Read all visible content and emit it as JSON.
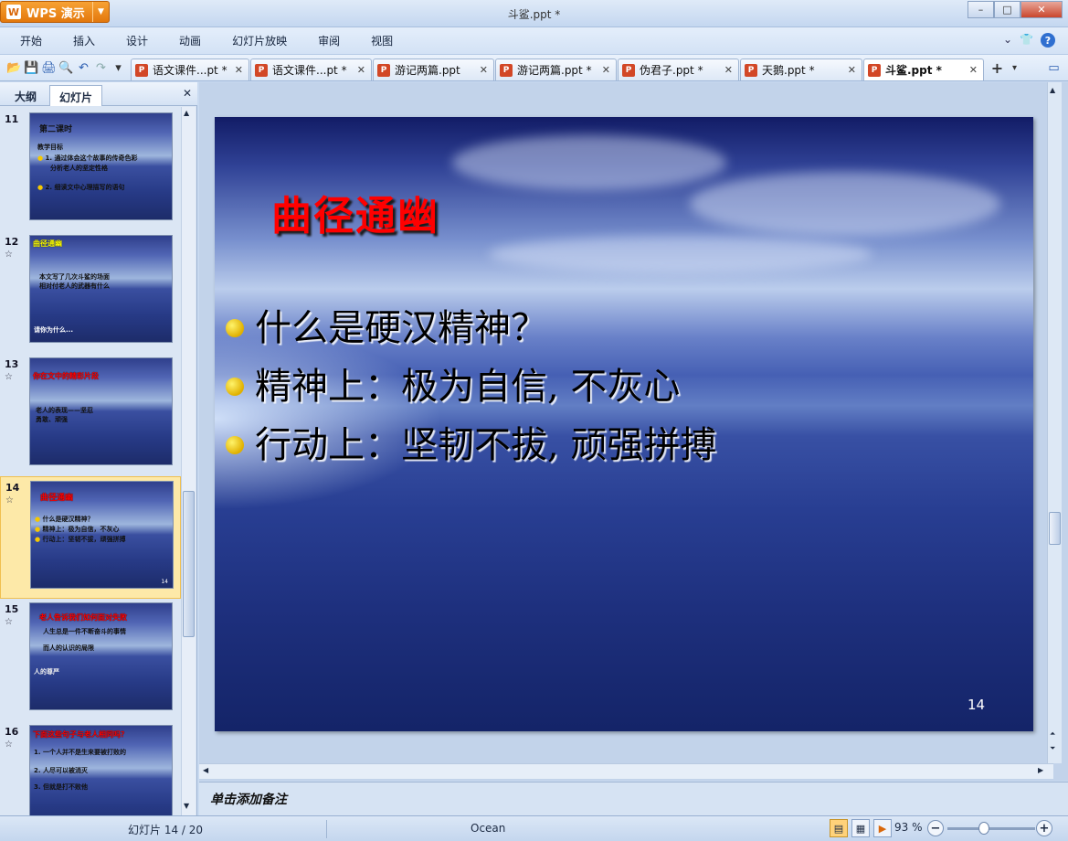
{
  "app": {
    "name": "WPS 演示",
    "logo_letter": "W",
    "title": "斗鲨.ppt *"
  },
  "window": {
    "minimize": "–",
    "maximize": "□",
    "close": "✕"
  },
  "menu": [
    "开始",
    "插入",
    "设计",
    "动画",
    "幻灯片放映",
    "审阅",
    "视图"
  ],
  "menu_right": {
    "collapse": "⌄",
    "skin": "👕",
    "help": "?"
  },
  "quick_toolbar": {
    "open": "📂",
    "save": "💾",
    "print": "🖨",
    "preview": "🔍",
    "undo": "↶",
    "redo": "↷",
    "more": "▾"
  },
  "tabs": [
    {
      "label": "语文课件...pt *",
      "active": false
    },
    {
      "label": "语文课件...pt *",
      "active": false
    },
    {
      "label": "游记两篇.ppt",
      "active": false
    },
    {
      "label": "游记两篇.ppt *",
      "active": false
    },
    {
      "label": "伪君子.ppt *",
      "active": false
    },
    {
      "label": "天鹅.ppt *",
      "active": false
    },
    {
      "label": "斗鲨.ppt *",
      "active": true
    }
  ],
  "tab_close": "✕",
  "tab_add": "+",
  "panel": {
    "tab_outline": "大纲",
    "tab_slides": "幻灯片",
    "close": "✕"
  },
  "thumbnails": [
    {
      "num": "11",
      "star": "",
      "title": "第二课时",
      "lines": [
        "教学目标",
        "1. 通过体会这个故事的传奇色彩",
        "分析老人的坚定性格",
        "2. 细读文中心理描写的语句"
      ],
      "selected": false
    },
    {
      "num": "12",
      "star": "☆",
      "title": "曲径通幽",
      "lines": [
        "本文写了几次斗鲨的场面",
        "相对付老人的武器有什么",
        "请你为什么..."
      ],
      "selected": false
    },
    {
      "num": "13",
      "star": "☆",
      "title": "你在文中的精彩片段",
      "lines": [
        "老人的表现——坚忍",
        "勇敢、顽强"
      ],
      "selected": false
    },
    {
      "num": "14",
      "star": "☆",
      "title": "曲径通幽",
      "lines": [
        "什么是硬汉精神？",
        "精神上：极为自信，不灰心",
        "行动上：坚韧不拔，顽强拼搏"
      ],
      "selected": true
    },
    {
      "num": "15",
      "star": "☆",
      "title": "老人告诉我们如何面对失败",
      "lines": [
        "人生总是一件不断奋斗的事情",
        "而人的认识的局限",
        "人的尊严"
      ],
      "selected": false
    },
    {
      "num": "16",
      "star": "☆",
      "title": "下面这些句子与老人相同吗？",
      "lines": [
        "1. 一个人并不是生来要被打败的",
        "2. 人尽可以被消灭",
        "3. 但就是打不败他"
      ],
      "selected": false
    }
  ],
  "slide": {
    "title": "曲径通幽",
    "bullets": [
      "什么是硬汉精神？",
      "精神上：极为自信, 不灰心",
      "行动上：坚韧不拔, 顽强拼搏"
    ],
    "number": "14"
  },
  "notes_placeholder": "单击添加备注",
  "status": {
    "slide_info": "幻灯片 14 / 20",
    "theme": "Ocean",
    "zoom": "93 %",
    "zoom_level": 0.5
  },
  "colors": {
    "title_red": "#ff0000",
    "bullet_yellow": "#f5c800",
    "accent_orange": "#e3780c"
  }
}
